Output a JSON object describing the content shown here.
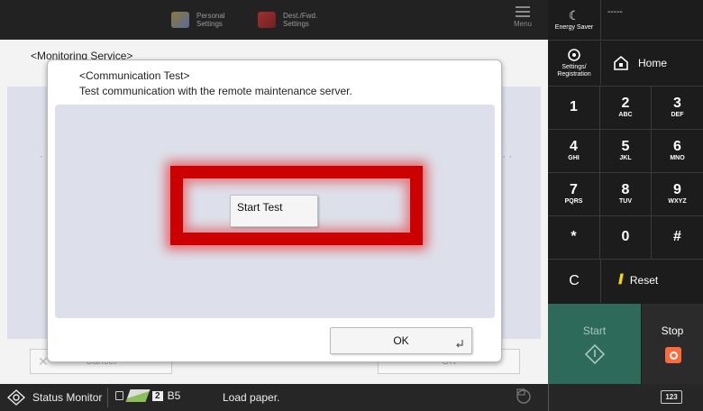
{
  "topbar": {
    "personal_settings": "Personal\nSettings",
    "dest_fwd_settings": "Dest./Fwd.\nSettings",
    "menu_label": "Menu",
    "energy_saver": "Energy Saver",
    "dashes": "-----"
  },
  "background": {
    "title": "<Monitoring Service>",
    "dots_left": "· ·",
    "dots_right": "· ·",
    "cancel_label": "Cancel",
    "ok_label": "OK"
  },
  "dialog": {
    "title": "<Communication Test>",
    "description": "Test communication with the remote maintenance server.",
    "start_test_label": "Start Test",
    "ok_label": "OK"
  },
  "sidepanel": {
    "settings_registration": "Settings/\nRegistration",
    "home_label": "Home",
    "keys": [
      {
        "num": "1",
        "sub": ""
      },
      {
        "num": "2",
        "sub": "ABC"
      },
      {
        "num": "3",
        "sub": "DEF"
      },
      {
        "num": "4",
        "sub": "GHI"
      },
      {
        "num": "5",
        "sub": "JKL"
      },
      {
        "num": "6",
        "sub": "MNO"
      },
      {
        "num": "7",
        "sub": "PQRS"
      },
      {
        "num": "8",
        "sub": "TUV"
      },
      {
        "num": "9",
        "sub": "WXYZ"
      },
      {
        "num": "*",
        "sub": ""
      },
      {
        "num": "0",
        "sub": ""
      },
      {
        "num": "#",
        "sub": ""
      }
    ],
    "clear_label": "C",
    "reset_label": "Reset",
    "start_label": "Start",
    "stop_label": "Stop"
  },
  "statusbar": {
    "status_monitor": "Status Monitor",
    "tray_number": "2",
    "paper_size": "B5",
    "message": "Load paper.",
    "keypad_label": "123"
  },
  "colors": {
    "highlight": "#cc0000",
    "start_button": "#2e6a5a",
    "stop_icon": "#ff6a3d",
    "reset_icon": "#f5d800"
  }
}
